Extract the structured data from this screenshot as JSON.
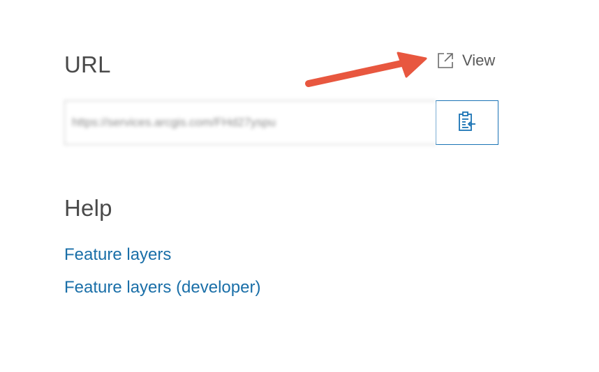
{
  "url_section": {
    "title": "URL",
    "view_label": "View",
    "url_value": "https://services.arcgis.com/FHd27yspu",
    "copy_icon": "clipboard-copy-icon",
    "view_icon": "external-link-icon"
  },
  "help_section": {
    "title": "Help",
    "links": [
      {
        "label": "Feature layers"
      },
      {
        "label": "Feature layers (developer)"
      }
    ]
  },
  "colors": {
    "link": "#1a6fa8",
    "button_border": "#1a73b5",
    "annotation_arrow": "#e8573f",
    "heading": "#4a4a4a"
  }
}
